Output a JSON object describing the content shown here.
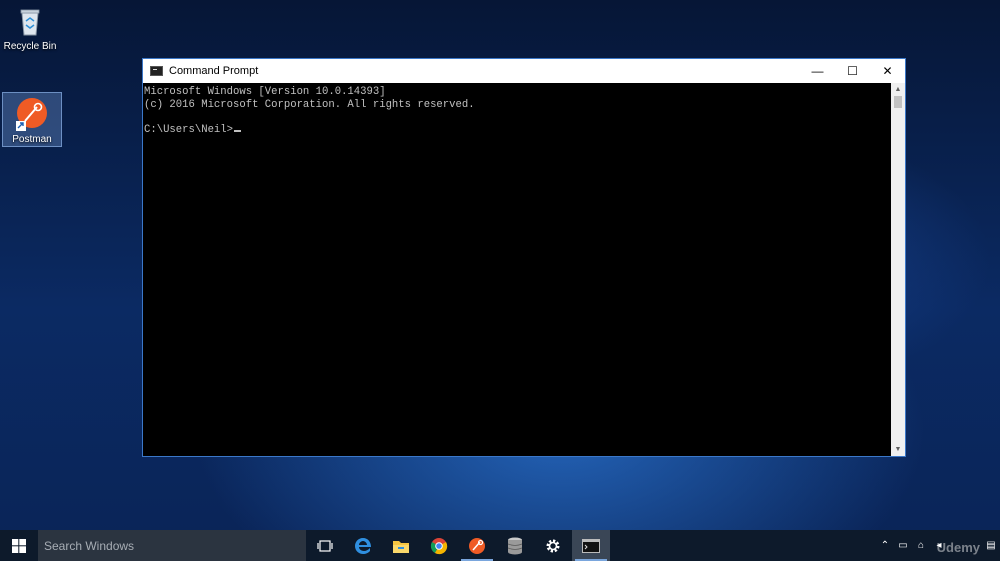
{
  "desktop": {
    "icons": [
      {
        "label": "Recycle Bin",
        "icon": "recycle-bin-icon"
      },
      {
        "label": "Postman",
        "icon": "postman-icon"
      }
    ]
  },
  "window": {
    "title": "Command Prompt",
    "controls": {
      "minimize": "—",
      "maximize": "☐",
      "close": "✕"
    },
    "console_lines": [
      "Microsoft Windows [Version 10.0.14393]",
      "(c) 2016 Microsoft Corporation. All rights reserved.",
      "",
      "C:\\Users\\Neil>"
    ]
  },
  "taskbar": {
    "search_placeholder": "Search Windows",
    "apps": [
      {
        "name": "task-view-icon"
      },
      {
        "name": "edge-icon"
      },
      {
        "name": "file-explorer-icon"
      },
      {
        "name": "chrome-icon"
      },
      {
        "name": "postman-taskbar-icon"
      },
      {
        "name": "database-icon"
      },
      {
        "name": "settings-gear-icon"
      },
      {
        "name": "command-prompt-taskbar-icon"
      }
    ],
    "watermark": "Udemy"
  },
  "colors": {
    "accent": "#3b78c9",
    "console_text": "#c0c0c0",
    "taskbar": "#0d1a2b"
  }
}
